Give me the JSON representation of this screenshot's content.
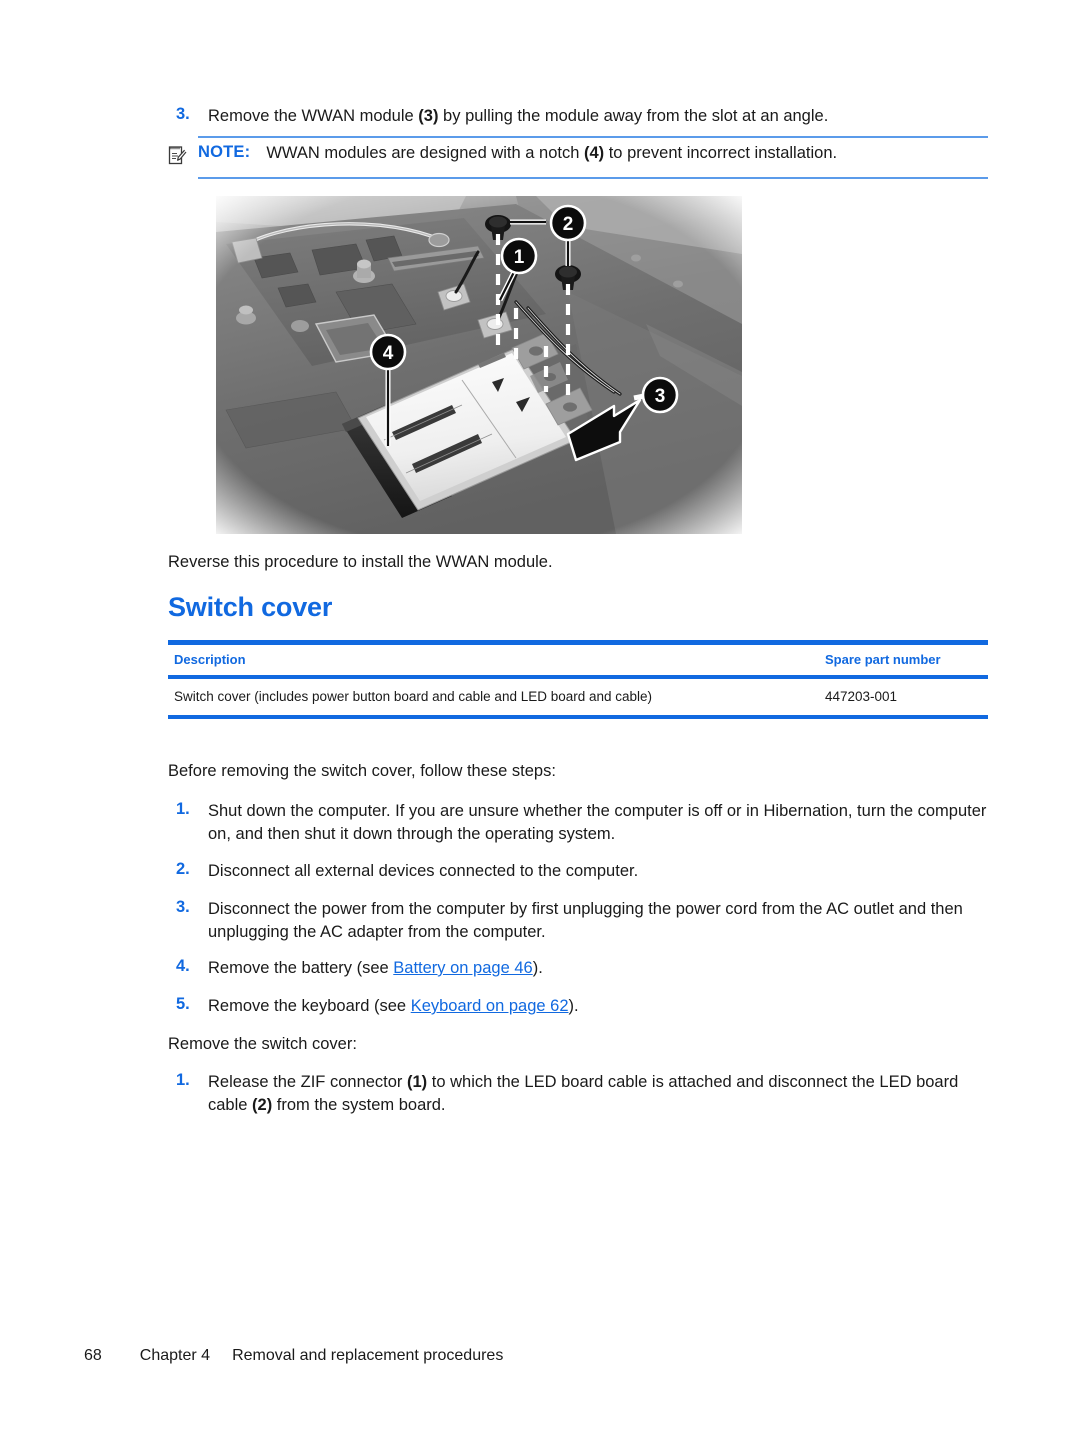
{
  "step_top": {
    "number": "3.",
    "text_before": "Remove the WWAN module ",
    "callout": "(3)",
    "text_after": " by pulling the module away from the slot at an angle."
  },
  "note": {
    "icon": "note-pad-pencil-icon",
    "label": "NOTE:",
    "text_before": "WWAN modules are designed with a notch ",
    "callout": "(4)",
    "text_after": " to prevent incorrect installation.",
    "rule_color": "#5b9bea"
  },
  "figure": {
    "name": "wwan-module-removal-illustration",
    "callouts": [
      {
        "label": "1"
      },
      {
        "label": "2"
      },
      {
        "label": "3"
      },
      {
        "label": "4"
      }
    ]
  },
  "reverse_note": "Reverse this procedure to install the WWAN module.",
  "section": {
    "heading": "Switch cover",
    "heading_color": "#1169e0"
  },
  "table": {
    "headers": {
      "description": "Description",
      "spare": "Spare part number"
    },
    "rows": [
      {
        "description": "Switch cover (includes power button board and cable and LED board and cable)",
        "spare": "447203-001"
      }
    ],
    "rule_color": "#1169e0"
  },
  "intro": "Before removing the switch cover, follow these steps:",
  "prep_steps": [
    {
      "number": "1.",
      "text": "Shut down the computer. If you are unsure whether the computer is off or in Hibernation, turn the computer on, and then shut it down through the operating system."
    },
    {
      "number": "2.",
      "text": "Disconnect all external devices connected to the computer."
    },
    {
      "number": "3.",
      "text": "Disconnect the power from the computer by first unplugging the power cord from the AC outlet and then unplugging the AC adapter from the computer."
    },
    {
      "number": "4.",
      "text_before": "Remove the battery (see ",
      "link": "Battery on page 46",
      "text_after": ")."
    },
    {
      "number": "5.",
      "text_before": "Remove the keyboard (see ",
      "link": "Keyboard on page 62",
      "text_after": ")."
    }
  ],
  "remove_intro": "Remove the switch cover:",
  "remove_steps": [
    {
      "number": "1.",
      "text_before": "Release the ZIF connector ",
      "callout_1": "(1)",
      "text_mid": " to which the LED board cable is attached and disconnect the LED board cable ",
      "callout_2": "(2)",
      "text_after": " from the system board."
    }
  ],
  "footer": {
    "page": "68",
    "chapter": "Chapter 4",
    "title": "Removal and replacement procedures"
  }
}
